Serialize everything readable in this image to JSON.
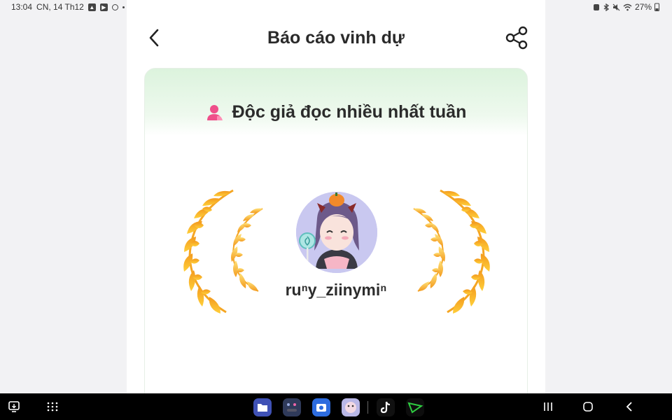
{
  "status_bar": {
    "time": "13:04",
    "date": "CN, 14 Th12",
    "battery": "27%"
  },
  "header": {
    "title": "Báo cáo vinh dự"
  },
  "card": {
    "title": "Độc giả đọc nhiều nhất tuần",
    "username": "ruⁿy_ziinymiⁿ"
  },
  "colors": {
    "card_gradient_top": "#dcf3dd",
    "laurel_light": "#ffd54a",
    "laurel_dark": "#f39a1e",
    "user_icon": "#ef4f8a",
    "avatar_bg": "#c9c8f0"
  },
  "icons": {
    "back": "chevron-left-icon",
    "share": "share-icon",
    "user": "user-icon",
    "nav_recents": "recents-icon",
    "nav_home": "home-icon",
    "nav_back": "back-icon"
  }
}
